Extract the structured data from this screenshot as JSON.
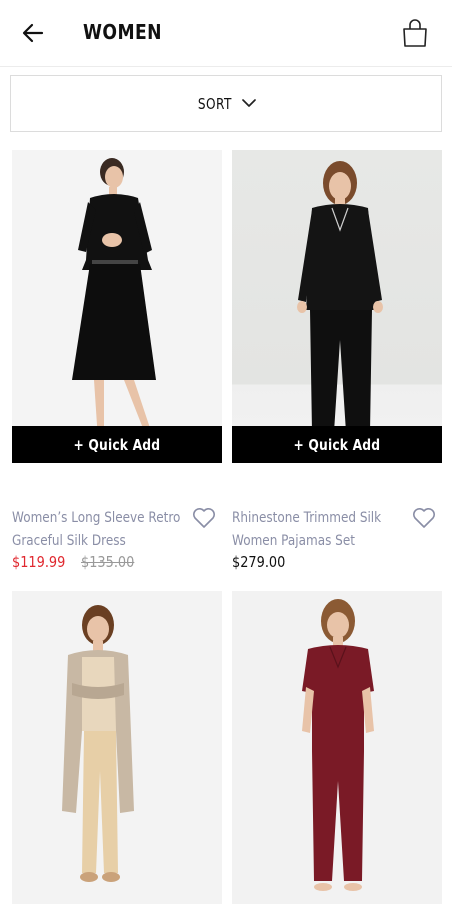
{
  "header": {
    "title": "WOMEN",
    "back_icon": "arrow-left-icon",
    "bag_icon": "shopping-bag-icon"
  },
  "sort": {
    "label": "SORT",
    "icon": "chevron-down-icon"
  },
  "products": [
    {
      "quick_add": "+ Quick Add",
      "name_line1": "Women’s Long Sleeve Retro",
      "name_line2": "Graceful Silk Dress",
      "sale_price": "$119.99",
      "original_price": "$135.00"
    },
    {
      "quick_add": "+ Quick Add",
      "name_line1": "Rhinestone Trimmed Silk",
      "name_line2": "Women Pajamas Set",
      "price": "$279.00"
    },
    {},
    {}
  ],
  "colors": {
    "sale_red": "#e0282f",
    "name_gray": "#8a8ea6",
    "quick_add_bg": "#000000"
  }
}
